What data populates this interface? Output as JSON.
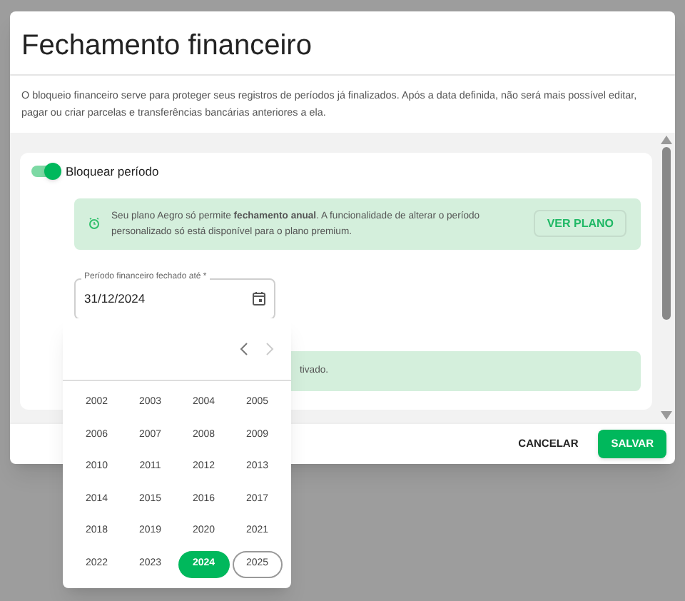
{
  "dialog": {
    "title": "Fechamento financeiro",
    "description": "O bloqueio financeiro serve para proteger seus registros de períodos já finalizados. Após a data definida, não será mais possível editar, pagar ou criar parcelas e transferências bancárias anteriores a ela."
  },
  "lock_toggle": {
    "label": "Bloquear período",
    "on": true
  },
  "plan_alert": {
    "text": "Seu plano Aegro só permite **fechamento anual**. A funcionalidade de alterar o período personalizado só está disponível para o plano premium.",
    "button": "VER PLANO"
  },
  "date_field": {
    "label": "Período financeiro fechado até *",
    "value": "31/12/2024"
  },
  "info_alert": {
    "text": "tivado."
  },
  "year_picker": {
    "prev_disabled": false,
    "next_disabled": true,
    "years": [
      {
        "label": "2002",
        "selected": false,
        "today": false
      },
      {
        "label": "2003",
        "selected": false,
        "today": false
      },
      {
        "label": "2004",
        "selected": false,
        "today": false
      },
      {
        "label": "2005",
        "selected": false,
        "today": false
      },
      {
        "label": "2006",
        "selected": false,
        "today": false
      },
      {
        "label": "2007",
        "selected": false,
        "today": false
      },
      {
        "label": "2008",
        "selected": false,
        "today": false
      },
      {
        "label": "2009",
        "selected": false,
        "today": false
      },
      {
        "label": "2010",
        "selected": false,
        "today": false
      },
      {
        "label": "2011",
        "selected": false,
        "today": false
      },
      {
        "label": "2012",
        "selected": false,
        "today": false
      },
      {
        "label": "2013",
        "selected": false,
        "today": false
      },
      {
        "label": "2014",
        "selected": false,
        "today": false
      },
      {
        "label": "2015",
        "selected": false,
        "today": false
      },
      {
        "label": "2016",
        "selected": false,
        "today": false
      },
      {
        "label": "2017",
        "selected": false,
        "today": false
      },
      {
        "label": "2018",
        "selected": false,
        "today": false
      },
      {
        "label": "2019",
        "selected": false,
        "today": false
      },
      {
        "label": "2020",
        "selected": false,
        "today": false
      },
      {
        "label": "2021",
        "selected": false,
        "today": false
      },
      {
        "label": "2022",
        "selected": false,
        "today": false
      },
      {
        "label": "2023",
        "selected": false,
        "today": false
      },
      {
        "label": "2024",
        "selected": true,
        "today": false
      },
      {
        "label": "2025",
        "selected": false,
        "today": true
      }
    ]
  },
  "footer": {
    "cancel": "CANCELAR",
    "save": "SALVAR"
  }
}
